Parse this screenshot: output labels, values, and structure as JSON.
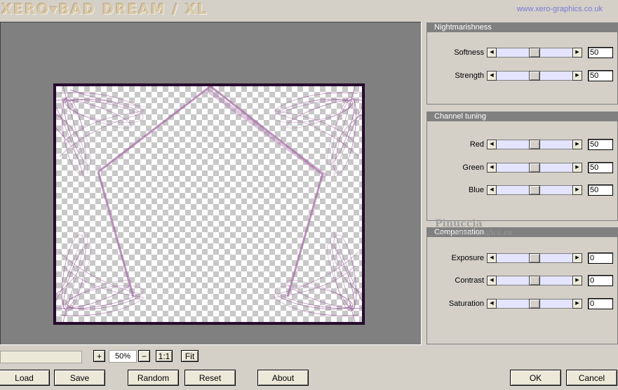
{
  "header": {
    "logo": "XERO▾BAD DREAM / XL",
    "website": "www.xero-graphics.co.uk"
  },
  "zoom": {
    "plus": "+",
    "value": "50%",
    "minus": "−",
    "one_to_one": "1:1",
    "fit": "Fit"
  },
  "buttons": {
    "load": "Load",
    "save": "Save",
    "random": "Random",
    "reset": "Reset",
    "about": "About",
    "ok": "OK",
    "cancel": "Cancel"
  },
  "panels": [
    {
      "title": "Nightmarishness",
      "rows": [
        {
          "label": "Softness",
          "value": "50",
          "level": 0.5
        },
        {
          "label": "Strength",
          "value": "50",
          "level": 0.5
        }
      ]
    },
    {
      "title": "Channel tuning",
      "rows": [
        {
          "label": "Red",
          "value": "50",
          "level": 0.5
        },
        {
          "label": "Green",
          "value": "50",
          "level": 0.5
        },
        {
          "label": "Blue",
          "value": "50",
          "level": 0.5
        }
      ]
    },
    {
      "title": "Compensation",
      "rows": [
        {
          "label": "Exposure",
          "value": "0",
          "level": 0.5
        },
        {
          "label": "Contrast",
          "value": "0",
          "level": 0.5
        },
        {
          "label": "Saturation",
          "value": "0",
          "level": 0.5
        }
      ]
    }
  ],
  "watermark": {
    "line1": "Pinuccia",
    "line2": "www.lunedigrafica.eu"
  },
  "colors": {
    "frame": "#2a0c32",
    "design": "#9a5a9a",
    "slider_track": "#e4e4ff"
  }
}
